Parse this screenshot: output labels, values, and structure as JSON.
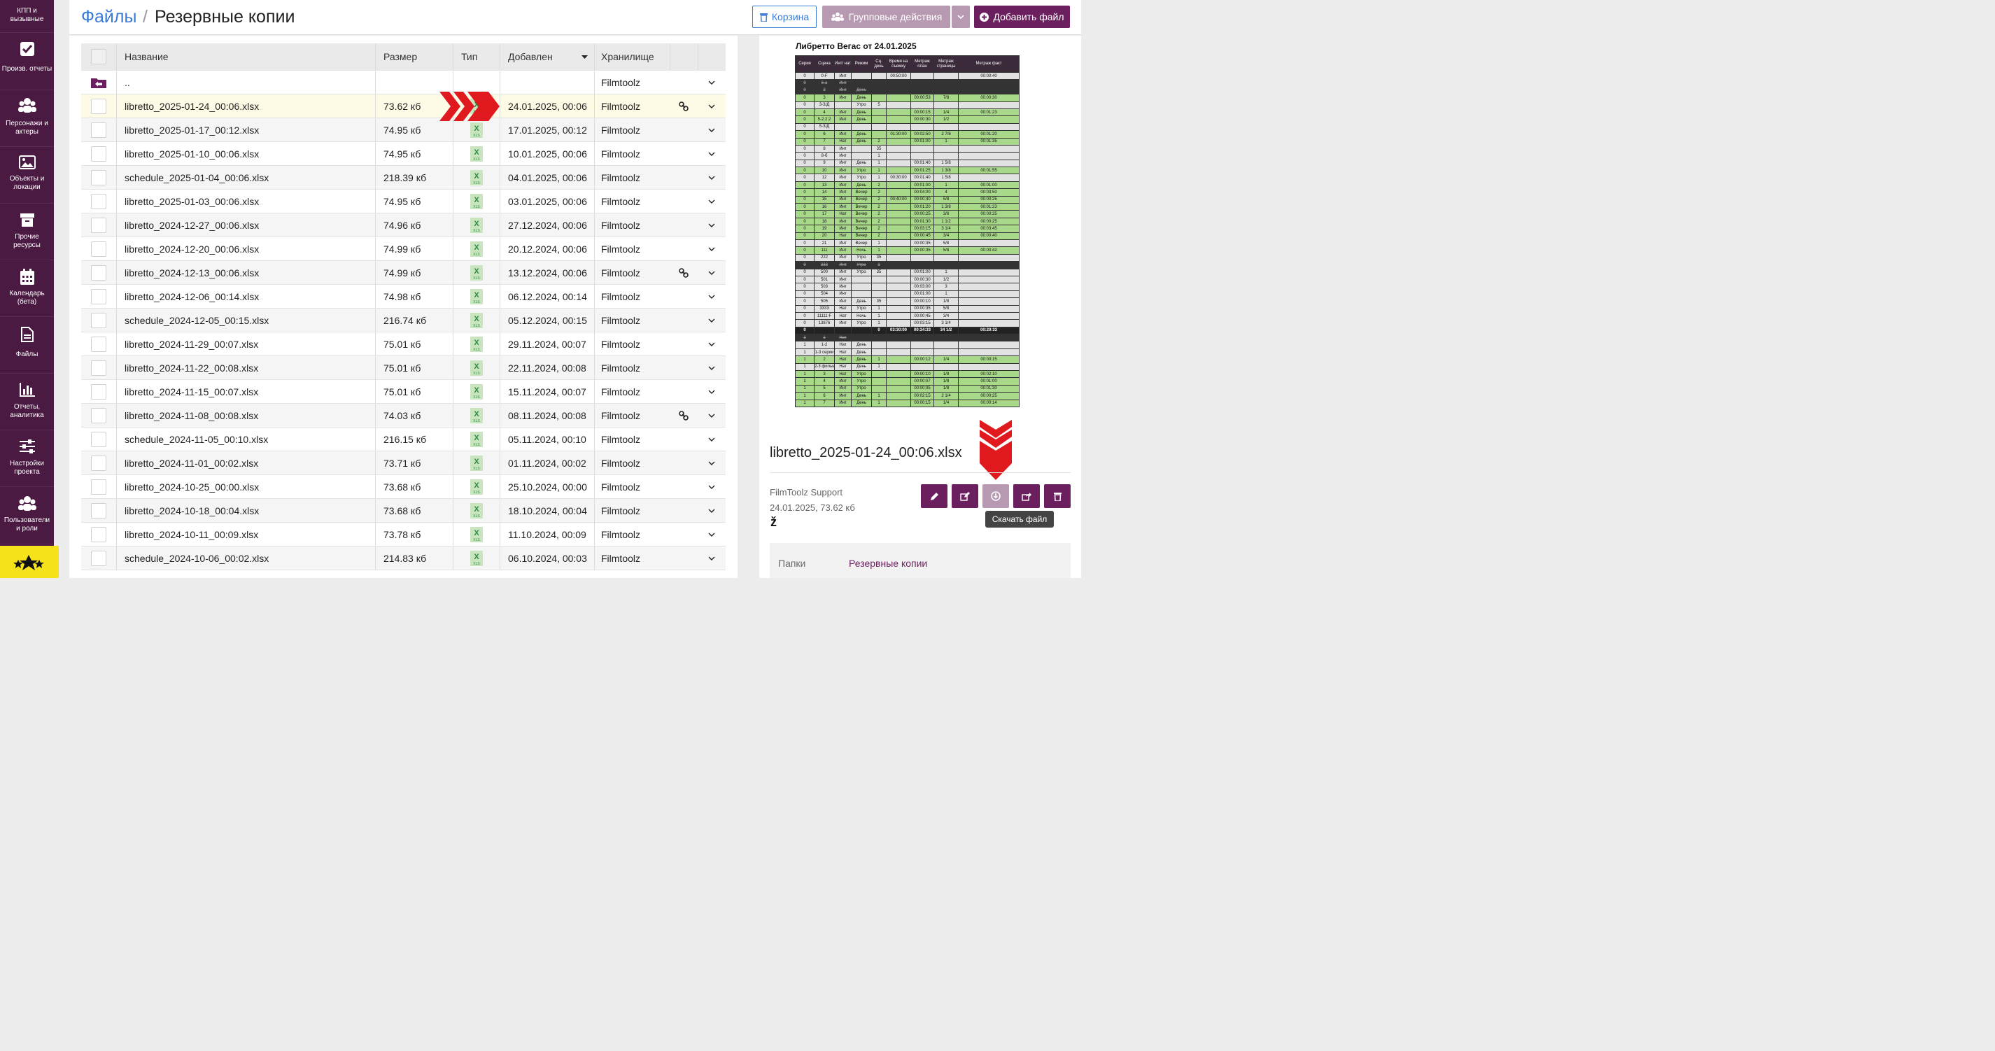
{
  "sidebar": {
    "items": [
      {
        "label": "КПП и вызывные",
        "icon": "kpp-icon"
      },
      {
        "label": "Произв. отчеты",
        "icon": "checkbox-icon"
      },
      {
        "label": "Персонажи и актеры",
        "icon": "people-icon"
      },
      {
        "label": "Объекты и локации",
        "icon": "image-icon"
      },
      {
        "label": "Прочие ресурсы",
        "icon": "box-icon"
      },
      {
        "label": "Календарь (бета)",
        "icon": "calendar-icon"
      },
      {
        "label": "Файлы",
        "icon": "file-icon"
      },
      {
        "label": "Отчеты, аналитика",
        "icon": "bar-chart-icon"
      },
      {
        "label": "Настройки проекта",
        "icon": "sliders-icon"
      },
      {
        "label": "Пользователи и роли",
        "icon": "users-icon"
      }
    ],
    "star_color": "#f5e21a"
  },
  "breadcrumb": {
    "root": "Файлы",
    "separator": "/",
    "current": "Резервные копии"
  },
  "header_buttons": {
    "trash": "Корзина",
    "group_actions": "Групповые действия",
    "add_file": "Добавить файл"
  },
  "table": {
    "headers": {
      "name": "Название",
      "size": "Размер",
      "type": "Тип",
      "added": "Добавлен",
      "storage": "Хранилище"
    },
    "parent_row": {
      "name": "..",
      "storage": "Filmtoolz"
    },
    "rows": [
      {
        "name": "libretto_2025-01-24_00:06.xlsx",
        "size": "73.62 кб",
        "date": "24.01.2025, 00:06",
        "storage": "Filmtoolz",
        "linked": true,
        "selected": true
      },
      {
        "name": "libretto_2025-01-17_00:12.xlsx",
        "size": "74.95 кб",
        "date": "17.01.2025, 00:12",
        "storage": "Filmtoolz",
        "linked": false
      },
      {
        "name": "libretto_2025-01-10_00:06.xlsx",
        "size": "74.95 кб",
        "date": "10.01.2025, 00:06",
        "storage": "Filmtoolz",
        "linked": false
      },
      {
        "name": "schedule_2025-01-04_00:06.xlsx",
        "size": "218.39 кб",
        "date": "04.01.2025, 00:06",
        "storage": "Filmtoolz",
        "linked": false
      },
      {
        "name": "libretto_2025-01-03_00:06.xlsx",
        "size": "74.95 кб",
        "date": "03.01.2025, 00:06",
        "storage": "Filmtoolz",
        "linked": false
      },
      {
        "name": "libretto_2024-12-27_00:06.xlsx",
        "size": "74.96 кб",
        "date": "27.12.2024, 00:06",
        "storage": "Filmtoolz",
        "linked": false
      },
      {
        "name": "libretto_2024-12-20_00:06.xlsx",
        "size": "74.99 кб",
        "date": "20.12.2024, 00:06",
        "storage": "Filmtoolz",
        "linked": false
      },
      {
        "name": "libretto_2024-12-13_00:06.xlsx",
        "size": "74.99 кб",
        "date": "13.12.2024, 00:06",
        "storage": "Filmtoolz",
        "linked": true
      },
      {
        "name": "libretto_2024-12-06_00:14.xlsx",
        "size": "74.98 кб",
        "date": "06.12.2024, 00:14",
        "storage": "Filmtoolz",
        "linked": false
      },
      {
        "name": "schedule_2024-12-05_00:15.xlsx",
        "size": "216.74 кб",
        "date": "05.12.2024, 00:15",
        "storage": "Filmtoolz",
        "linked": false
      },
      {
        "name": "libretto_2024-11-29_00:07.xlsx",
        "size": "75.01 кб",
        "date": "29.11.2024, 00:07",
        "storage": "Filmtoolz",
        "linked": false
      },
      {
        "name": "libretto_2024-11-22_00:08.xlsx",
        "size": "75.01 кб",
        "date": "22.11.2024, 00:08",
        "storage": "Filmtoolz",
        "linked": false
      },
      {
        "name": "libretto_2024-11-15_00:07.xlsx",
        "size": "75.01 кб",
        "date": "15.11.2024, 00:07",
        "storage": "Filmtoolz",
        "linked": false
      },
      {
        "name": "libretto_2024-11-08_00:08.xlsx",
        "size": "74.03 кб",
        "date": "08.11.2024, 00:08",
        "storage": "Filmtoolz",
        "linked": true
      },
      {
        "name": "schedule_2024-11-05_00:10.xlsx",
        "size": "216.15 кб",
        "date": "05.11.2024, 00:10",
        "storage": "Filmtoolz",
        "linked": false
      },
      {
        "name": "libretto_2024-11-01_00:02.xlsx",
        "size": "73.71 кб",
        "date": "01.11.2024, 00:02",
        "storage": "Filmtoolz",
        "linked": false
      },
      {
        "name": "libretto_2024-10-25_00:00.xlsx",
        "size": "73.68 кб",
        "date": "25.10.2024, 00:00",
        "storage": "Filmtoolz",
        "linked": false
      },
      {
        "name": "libretto_2024-10-18_00:04.xlsx",
        "size": "73.68 кб",
        "date": "18.10.2024, 00:04",
        "storage": "Filmtoolz",
        "linked": false
      },
      {
        "name": "libretto_2024-10-11_00:09.xlsx",
        "size": "73.78 кб",
        "date": "11.10.2024, 00:09",
        "storage": "Filmtoolz",
        "linked": false
      },
      {
        "name": "schedule_2024-10-06_00:02.xlsx",
        "size": "214.83 кб",
        "date": "06.10.2024, 00:03",
        "storage": "Filmtoolz",
        "linked": false
      }
    ]
  },
  "preview": {
    "sheet_title": "Либретто Вегас от 24.01.2025",
    "columns": [
      "Серия",
      "Сцена",
      "Инт/ нат",
      "Режим",
      "Сц. день",
      "Время на съемку",
      "Метраж план",
      "Метраж страницы",
      "Метраж факт"
    ],
    "sheet_rows": [
      {
        "k": "w",
        "c": [
          "0",
          "0-F",
          "Инт",
          "",
          "",
          "00:50:00",
          "",
          "",
          "00:00:40"
        ]
      },
      {
        "k": "d",
        "c": [
          "0",
          "6-a",
          "Инт",
          "",
          "",
          "",
          "",
          "",
          ""
        ]
      },
      {
        "k": "d",
        "c": [
          "0",
          "2",
          "Инт",
          "День",
          "",
          "",
          "",
          "",
          ""
        ]
      },
      {
        "k": "g",
        "c": [
          "0",
          "3",
          "Инт",
          "День",
          "",
          "",
          "00:00:53",
          "7/8",
          "00:00:30"
        ]
      },
      {
        "k": "w",
        "c": [
          "0",
          "3-3/Д",
          "",
          "Утро",
          "5",
          "",
          "",
          "",
          ""
        ]
      },
      {
        "k": "g",
        "c": [
          "0",
          "4",
          "Инт",
          "День",
          "",
          "",
          "00:00:15",
          "1/4",
          "00:01:23"
        ]
      },
      {
        "k": "g",
        "c": [
          "0",
          "5-2.2.2",
          "Инт",
          "День",
          "",
          "",
          "00:00:30",
          "1/2",
          ""
        ]
      },
      {
        "k": "w",
        "c": [
          "0",
          "5-3/Д",
          "",
          "",
          "",
          "",
          "",
          "",
          ""
        ]
      },
      {
        "k": "g",
        "c": [
          "0",
          "6",
          "Инт",
          "День",
          "",
          "01:30:00",
          "00:02:50",
          "2 7/8",
          "00:01:20"
        ]
      },
      {
        "k": "g",
        "c": [
          "0",
          "7",
          "Нат",
          "День",
          "2",
          "",
          "00:01:00",
          "1",
          "00:01:35"
        ]
      },
      {
        "k": "w",
        "c": [
          "0",
          "8",
          "Инт",
          "",
          "35",
          "",
          "",
          "",
          ""
        ]
      },
      {
        "k": "w",
        "c": [
          "0",
          "8-б",
          "Инт",
          "",
          "1",
          "",
          "",
          "",
          ""
        ]
      },
      {
        "k": "w",
        "c": [
          "0",
          "9",
          "Инт",
          "День",
          "1",
          "",
          "00:01:40",
          "1 5/8",
          ""
        ]
      },
      {
        "k": "g",
        "c": [
          "0",
          "10",
          "Инт",
          "Утро",
          "1",
          "",
          "00:01:25",
          "1 3/8",
          "00:01:55"
        ]
      },
      {
        "k": "w",
        "c": [
          "0",
          "12",
          "Инт",
          "Утро",
          "1",
          "00:30:00",
          "00:01:40",
          "1 5/8",
          ""
        ]
      },
      {
        "k": "g",
        "c": [
          "0",
          "13",
          "Инт",
          "День",
          "2",
          "",
          "00:01:00",
          "1",
          "00:01:00"
        ]
      },
      {
        "k": "g",
        "c": [
          "0",
          "14",
          "Инт",
          "Вечер",
          "2",
          "",
          "00:04:00",
          "4",
          "00:03:50"
        ]
      },
      {
        "k": "g",
        "c": [
          "0",
          "15",
          "Инт",
          "Вечер",
          "2",
          "00:40:00",
          "00:00:40",
          "5/8",
          "00:00:25"
        ]
      },
      {
        "k": "g",
        "c": [
          "0",
          "16",
          "Инт",
          "Вечер",
          "2",
          "",
          "00:01:20",
          "1 3/8",
          "00:01:23"
        ]
      },
      {
        "k": "g",
        "c": [
          "0",
          "17",
          "Нат",
          "Вечер",
          "2",
          "",
          "00:00:25",
          "3/8",
          "00:00:25"
        ]
      },
      {
        "k": "g",
        "c": [
          "0",
          "18",
          "Инт",
          "Вечер",
          "2",
          "",
          "00:01:30",
          "1 1/2",
          "00:00:25"
        ]
      },
      {
        "k": "g",
        "c": [
          "0",
          "19",
          "Инт",
          "Вечер",
          "2",
          "",
          "00:03:15",
          "3 1/4",
          "00:03:45"
        ]
      },
      {
        "k": "g",
        "c": [
          "0",
          "20",
          "Нат",
          "Вечер",
          "2",
          "",
          "00:00:45",
          "3/4",
          "00:00:40"
        ]
      },
      {
        "k": "w",
        "c": [
          "0",
          "21",
          "Инт",
          "Вечер",
          "1",
          "",
          "00:00:35",
          "5/8",
          ""
        ]
      },
      {
        "k": "g",
        "c": [
          "0",
          "111",
          "Инт",
          "Ночь",
          "1",
          "",
          "00:00:35",
          "5/8",
          "00:00:42"
        ]
      },
      {
        "k": "w",
        "c": [
          "0",
          "222",
          "Инт",
          "Утро",
          "35",
          "",
          "",
          "",
          ""
        ]
      },
      {
        "k": "d",
        "c": [
          "0",
          "333",
          "Инт",
          "Утро",
          "1",
          "",
          "",
          "",
          ""
        ]
      },
      {
        "k": "w",
        "c": [
          "0",
          "500",
          "Инт",
          "Утро",
          "35",
          "",
          "00:01:00",
          "1",
          ""
        ]
      },
      {
        "k": "w",
        "c": [
          "0",
          "501",
          "Инт",
          "",
          "",
          "",
          "00:00:30",
          "1/2",
          ""
        ]
      },
      {
        "k": "w",
        "c": [
          "0",
          "503",
          "Инт",
          "",
          "",
          "",
          "00:03:00",
          "3",
          ""
        ]
      },
      {
        "k": "w",
        "c": [
          "0",
          "504",
          "Инт",
          "",
          "",
          "",
          "00:01:00",
          "1",
          ""
        ]
      },
      {
        "k": "w",
        "c": [
          "0",
          "505",
          "Инт",
          "День",
          "35",
          "",
          "00:00:10",
          "1/8",
          ""
        ]
      },
      {
        "k": "w",
        "c": [
          "0",
          "3333",
          "Нат",
          "Утро",
          "1",
          "",
          "00:00:35",
          "5/8",
          ""
        ]
      },
      {
        "k": "w",
        "c": [
          "0",
          "11111-F",
          "Нат",
          "Ночь",
          "1",
          "",
          "00:00:45",
          "3/4",
          ""
        ]
      },
      {
        "k": "w",
        "c": [
          "0",
          "13876",
          "Инт",
          "Утро",
          "1",
          "",
          "00:03:15",
          "3 1/4",
          ""
        ]
      },
      {
        "k": "t",
        "c": [
          "0",
          "",
          "",
          "",
          "0",
          "03:30:00",
          "00:34:33",
          "34 1/2",
          "00:20:33"
        ]
      },
      {
        "k": "d",
        "c": [
          "1",
          "1",
          "Нат",
          "",
          "",
          "",
          "",
          "",
          ""
        ]
      },
      {
        "k": "w",
        "c": [
          "1",
          "1-2",
          "Нат",
          "День",
          "",
          "",
          "",
          "",
          ""
        ]
      },
      {
        "k": "w",
        "c": [
          "1",
          "1-3 серии",
          "Нат",
          "День",
          "",
          "",
          "",
          "",
          ""
        ]
      },
      {
        "k": "g",
        "c": [
          "1",
          "2",
          "Нат",
          "День",
          "1",
          "",
          "00:00:12",
          "1/4",
          "00:00:15"
        ]
      },
      {
        "k": "w",
        "c": [
          "1",
          "2-3 фильм",
          "Нат",
          "День",
          "1",
          "",
          "",
          "",
          ""
        ]
      },
      {
        "k": "g",
        "c": [
          "1",
          "3",
          "Нат",
          "Утро",
          "",
          "",
          "00:00:10",
          "1/8",
          "00:02:10"
        ]
      },
      {
        "k": "g",
        "c": [
          "1",
          "4",
          "Инт",
          "Утро",
          "",
          "",
          "00:00:07",
          "1/8",
          "00:01:00"
        ]
      },
      {
        "k": "g",
        "c": [
          "1",
          "5",
          "Инт",
          "Утро",
          "",
          "",
          "00:00:05",
          "1/8",
          "00:01:30"
        ]
      },
      {
        "k": "g",
        "c": [
          "1",
          "6",
          "Инт",
          "День",
          "1",
          "",
          "00:02:15",
          "2 1/4",
          "00:00:25"
        ]
      },
      {
        "k": "g",
        "c": [
          "1",
          "7",
          "Инт",
          "День",
          "1",
          "",
          "00:00:15",
          "1/4",
          "00:00:14"
        ]
      }
    ],
    "file_name": "libretto_2025-01-24_00:06.xlsx",
    "author": "FilmToolz Support",
    "meta": "24.01.2025, 73.62 кб",
    "z_mark": "ž",
    "tooltip": "Скачать файл",
    "folders_label": "Папки",
    "folders_value": "Резервные копии"
  },
  "colors": {
    "brand": "#6b1f5e",
    "sidebar": "#4a1a42",
    "link": "#3a7bd5",
    "arrow": "#e0191f"
  }
}
